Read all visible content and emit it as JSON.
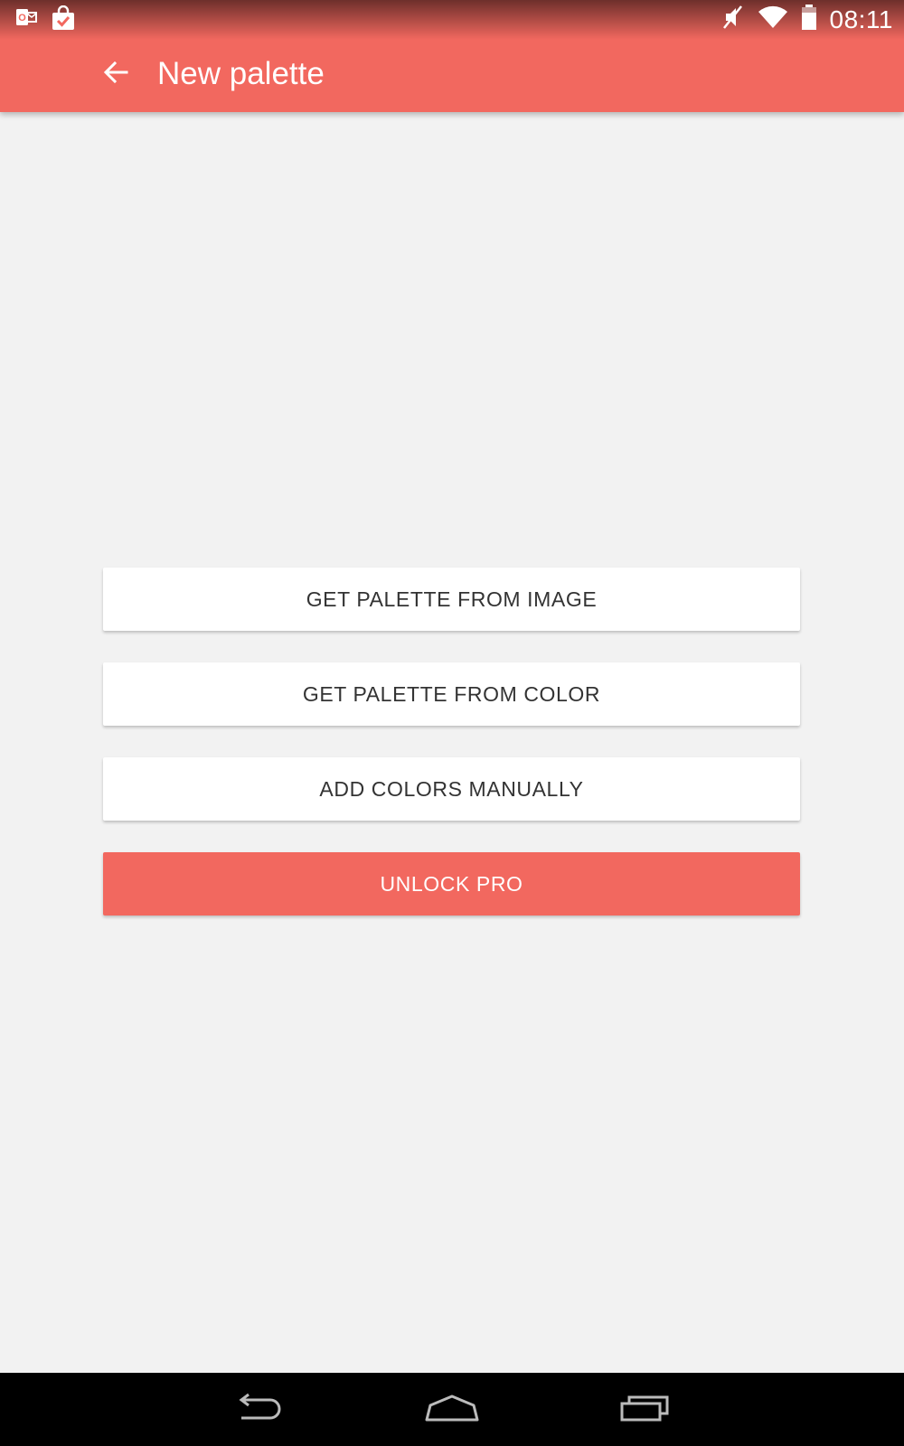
{
  "status_bar": {
    "time": "08:11",
    "left_icons": [
      "outlook-icon",
      "shopping-bag-check-icon"
    ],
    "right_icons": [
      "mute-icon",
      "wifi-icon",
      "battery-icon"
    ]
  },
  "app_bar": {
    "title": "New palette",
    "back_icon": "arrow-back-icon",
    "color": "#f2685f"
  },
  "actions": [
    {
      "label": "GET PALETTE FROM IMAGE"
    },
    {
      "label": "GET PALETTE FROM COLOR"
    },
    {
      "label": "ADD COLORS MANUALLY"
    },
    {
      "label": "UNLOCK PRO"
    }
  ],
  "nav_bar": {
    "icons": [
      "back-nav-icon",
      "home-nav-icon",
      "recents-nav-icon"
    ]
  },
  "colors": {
    "accent": "#f2685f",
    "background": "#f2f2f2",
    "button": "#ffffff",
    "button_text": "#333333"
  }
}
